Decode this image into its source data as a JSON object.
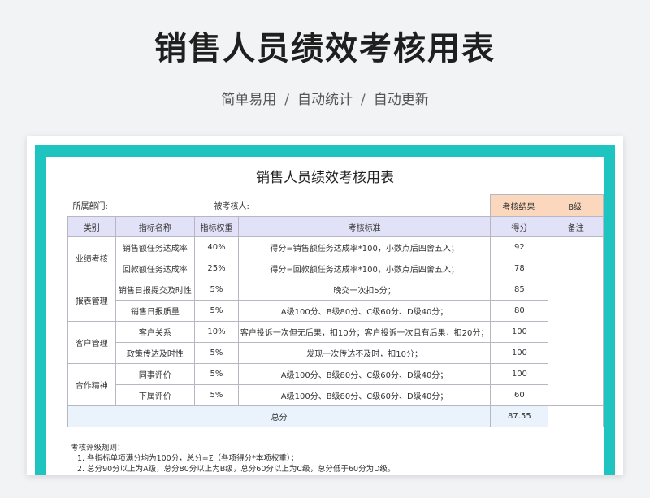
{
  "hero": {
    "title": "销售人员绩效考核用表",
    "subtitle": [
      "简单易用",
      "自动统计",
      "自动更新"
    ],
    "separator": "/"
  },
  "colors": {
    "frame": "#1fc4c1",
    "header_row": "#e1e1f7",
    "result_cells": "#fbd8bd",
    "total_row": "#eaf3fb"
  },
  "sheet": {
    "title": "销售人员绩效考核用表",
    "department_label": "所属部门:",
    "assessee_label": "被考核人:",
    "result_label": "考核结果",
    "result_value": "B级",
    "headers": [
      "类别",
      "指标名称",
      "指标权重",
      "考核标准",
      "得分",
      "备注"
    ],
    "groups": [
      {
        "category": "业绩考核",
        "rows": [
          {
            "name": "销售额任务达成率",
            "weight": "40%",
            "standard": "得分=销售额任务达成率*100，小数点后四舍五入；",
            "score": "92"
          },
          {
            "name": "回款额任务达成率",
            "weight": "25%",
            "standard": "得分=回款额任务达成率*100，小数点后四舍五入；",
            "score": "78"
          }
        ]
      },
      {
        "category": "报表管理",
        "rows": [
          {
            "name": "销售日报提交及时性",
            "weight": "5%",
            "standard": "晚交一次扣5分；",
            "score": "85"
          },
          {
            "name": "销售日报质量",
            "weight": "5%",
            "standard": "A级100分、B级80分、C级60分、D级40分；",
            "score": "80"
          }
        ]
      },
      {
        "category": "客户管理",
        "rows": [
          {
            "name": "客户关系",
            "weight": "10%",
            "standard": "客户投诉一次但无后果，扣10分；客户投诉一次且有后果，扣20分；",
            "score": "100"
          },
          {
            "name": "政策传达及时性",
            "weight": "5%",
            "standard": "发现一次传达不及时，扣10分；",
            "score": "100"
          }
        ]
      },
      {
        "category": "合作精神",
        "rows": [
          {
            "name": "同事评价",
            "weight": "5%",
            "standard": "A级100分、B级80分、C级60分、D级40分；",
            "score": "100"
          },
          {
            "name": "下属评价",
            "weight": "5%",
            "standard": "A级100分、B级80分、C级60分、D级40分；",
            "score": "60"
          }
        ]
      }
    ],
    "total_label": "总分",
    "total_value": "87.55",
    "rules": {
      "title": "考核评级规则：",
      "items": [
        "1. 各指标单项满分均为100分，总分=Σ（各项得分*本项权重）；",
        "2. 总分90分以上为A级，总分80分以上为B级，总分60分以上为C级，总分低于60分为D级。"
      ]
    }
  }
}
